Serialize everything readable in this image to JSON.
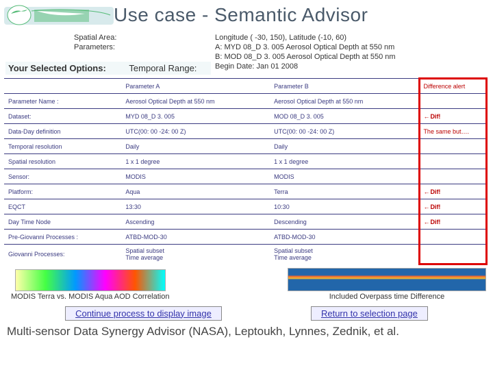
{
  "title": "Use case - Semantic Advisor",
  "info": {
    "left": {
      "selected_label": "Your Selected Options:"
    },
    "labels": {
      "spatial": "Spatial Area:",
      "params": "Parameters:",
      "temporal": "Temporal Range:"
    },
    "values": {
      "spatial": "Longitude ( -30, 150), Latitude (-10, 60)",
      "paramA": "A: MYD 08_D 3. 005 Aerosol Optical Depth at 550 nm",
      "paramB": "B: MOD 08_D 3. 005 Aerosol Optical Depth at 550 nm",
      "temporal": "Begin Date:  Jan 01 2008"
    }
  },
  "grid": {
    "headers": {
      "c1": "",
      "c2": "Parameter A",
      "c3": "Parameter B",
      "c4": "Difference alert"
    },
    "rows": [
      {
        "c1": "Parameter Name :",
        "c2": "Aerosol Optical Depth at 550 nm",
        "c3": "Aerosol Optical Depth at 550 nm",
        "c4": "",
        "indent": false
      },
      {
        "c1": "Dataset:",
        "c2": "MYD 08_D 3. 005",
        "c3": "MOD 08_D 3. 005",
        "c4": "Dif!",
        "indent": false,
        "diff": true
      },
      {
        "c1": "Data-Day definition",
        "c2": "UTC(00: 00 -24: 00 Z)",
        "c3": "UTC(00: 00 -24: 00 Z)",
        "c4": "The same but….",
        "indent": true,
        "same": true
      },
      {
        "c1": "Temporal resolution",
        "c2": "Daily",
        "c3": "Daily",
        "c4": "",
        "indent": true
      },
      {
        "c1": "Spatial resolution",
        "c2": "1 x 1 degree",
        "c3": "1 x 1 degree",
        "c4": "",
        "indent": true
      },
      {
        "c1": "Sensor:",
        "c2": "MODIS",
        "c3": "MODIS",
        "c4": "",
        "indent": false
      },
      {
        "c1": "Platform:",
        "c2": "Aqua",
        "c3": "Terra",
        "c4": "Dif!",
        "indent": false,
        "diff": true
      },
      {
        "c1": "EQCT",
        "c2": "13:30",
        "c3": "10:30",
        "c4": "Dif!",
        "indent": true,
        "diff": true
      },
      {
        "c1": "Day Time Node",
        "c2": "Ascending",
        "c3": "Descending",
        "c4": "Dif!",
        "indent": true,
        "diff": true
      },
      {
        "c1": "Pre-Giovanni Processes :",
        "c2": "ATBD-MOD-30",
        "c3": "ATBD-MOD-30",
        "c4": "",
        "indent": false
      },
      {
        "c1": "Giovanni Processes:",
        "c2": "Spatial subset\nTime average",
        "c3": "Spatial subset\nTime average",
        "c4": "",
        "indent": false
      }
    ]
  },
  "figs": {
    "left_caption": "MODIS Terra vs. MODIS Aqua AOD Correlation",
    "right_caption": "Included Overpass time Difference"
  },
  "buttons": {
    "continue": "Continue process to display image",
    "return": "Return to selection page"
  },
  "footer": "Multi-sensor Data Synergy Advisor (NASA), Leptoukh, Lynnes, Zednik, et al."
}
